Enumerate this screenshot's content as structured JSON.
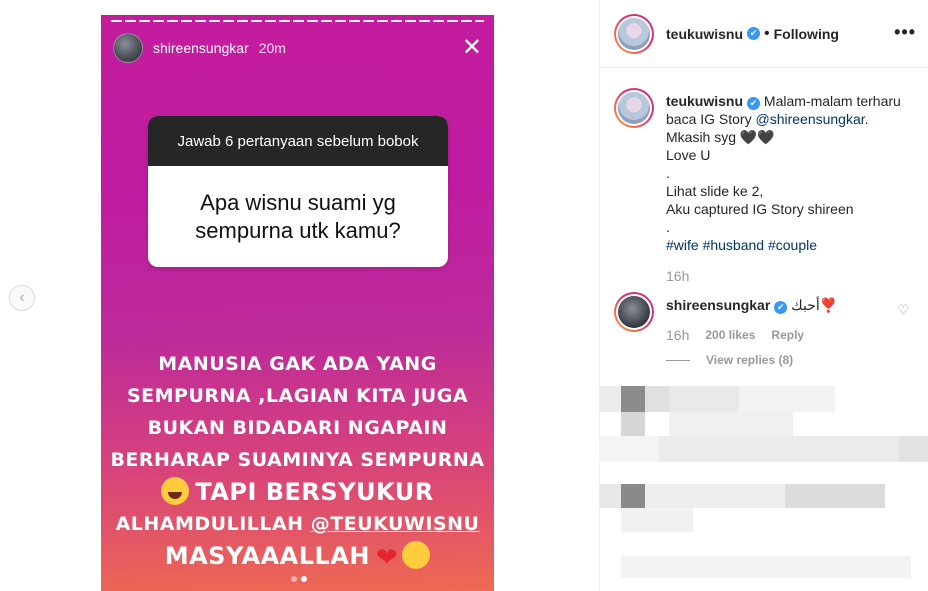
{
  "story": {
    "username": "shireensungkar",
    "time": "20m",
    "question_header": "Jawab 6 pertanyaan sebelum bobok",
    "question": "Apa wisnu suami yg sempurna utk kamu?",
    "answer_lines": [
      "MANUSIA GAK ADA YANG",
      "SEMPURNA ,LAGIAN KITA JUGA",
      "BUKAN BIDADARI NGAPAIN",
      "BERHARAP SUAMINYA SEMPURNA",
      "TAPI BERSYUKUR",
      "ALHAMDULILLAH ",
      "@TEUKUWISNU",
      "MASYAAALLAH"
    ],
    "close_icon": "close-icon"
  },
  "post": {
    "username": "teukuwisnu",
    "verified": "✔",
    "bullet": "•",
    "follow_label": "Following",
    "more": "•••"
  },
  "caption": {
    "username": "teukuwisnu",
    "line1": " Malam-malam terharu baca IG Story ",
    "mention": "@shireensungkar",
    "line1_end": ".",
    "line2": "Mkasih syg 🖤🖤",
    "line3": "Love U",
    "dot": ".",
    "line4": "Lihat slide ke 2,",
    "line5": "Aku captured IG Story shireen",
    "dot2": ".",
    "tags": [
      "#wife",
      "#husband",
      "#couple"
    ],
    "time": "16h"
  },
  "comment": {
    "username": "shireensungkar",
    "text": "أحبك❣️",
    "time": "16h",
    "likes": "200 likes",
    "reply": "Reply",
    "view_replies": "View replies (8)"
  },
  "colors": {
    "verified": "#3897f0",
    "link": "#003569",
    "muted": "#999999"
  }
}
